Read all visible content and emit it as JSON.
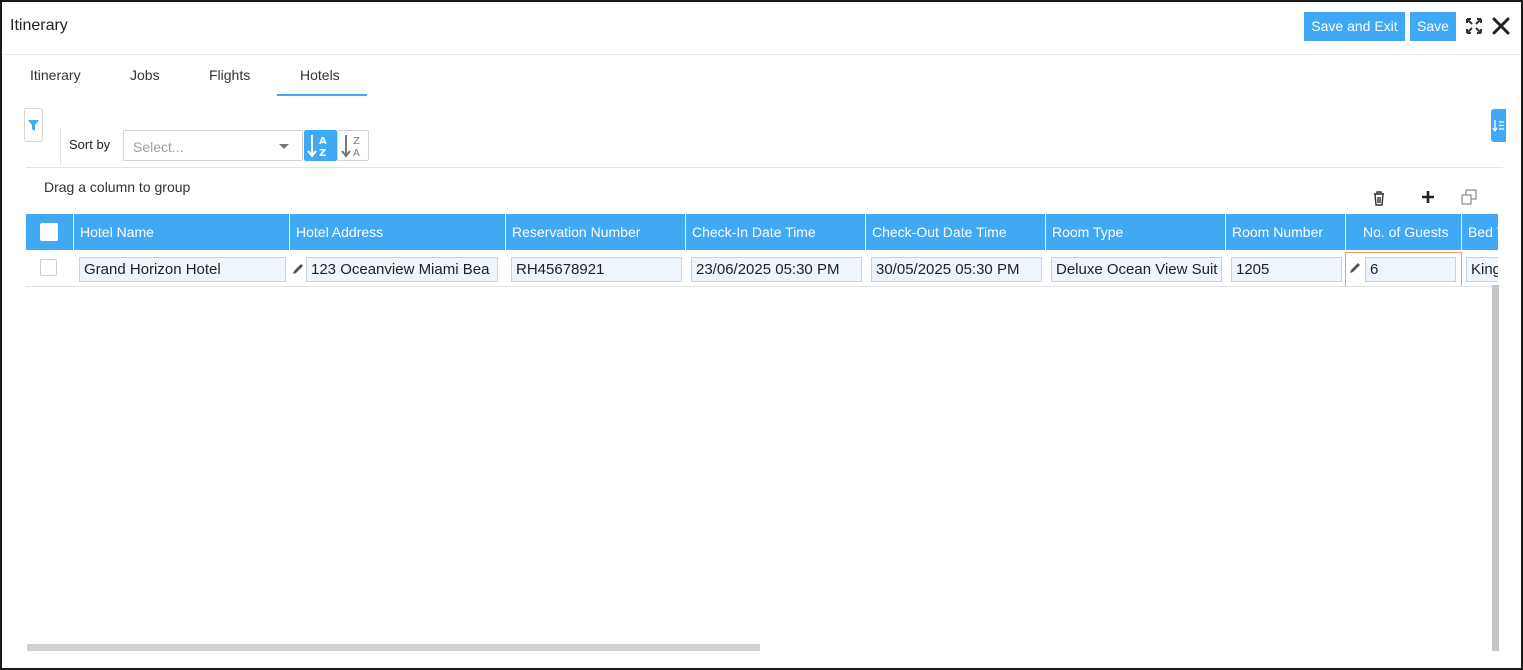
{
  "window": {
    "title": "Itinerary",
    "save_exit_label": "Save and Exit",
    "save_label": "Save"
  },
  "tabs": [
    {
      "label": "Itinerary",
      "active": false
    },
    {
      "label": "Jobs",
      "active": false
    },
    {
      "label": "Flights",
      "active": false
    },
    {
      "label": "Hotels",
      "active": true
    }
  ],
  "toolbar": {
    "sort_by_label": "Sort by",
    "sort_placeholder": "Select...",
    "group_hint": "Drag a column to group"
  },
  "grid": {
    "columns": [
      "Hotel Name",
      "Hotel Address",
      "Reservation Number",
      "Check-In Date Time",
      "Check-Out Date Time",
      "Room Type",
      "Room Number",
      "No. of Guests",
      "Bed T"
    ],
    "rows": [
      {
        "hotel_name": "Grand Horizon Hotel",
        "hotel_address": "123 Oceanview  Miami Bea",
        "reservation_number": "RH45678921",
        "check_in": "23/06/2025 05:30 PM",
        "check_out": "30/05/2025 05:30 PM",
        "room_type": "Deluxe Ocean View Suit",
        "room_number": "1205",
        "guests": "6",
        "bed_type": "King"
      }
    ]
  },
  "colors": {
    "accent": "#3fa9f5",
    "focus_border": "#f0a070",
    "input_bg": "#eef5fc"
  },
  "icons": [
    "expand-icon",
    "close-icon",
    "filter-icon",
    "sort-asc-icon",
    "sort-desc-icon",
    "column-chooser-icon",
    "trash-icon",
    "plus-icon",
    "copy-icon",
    "pencil-icon"
  ]
}
